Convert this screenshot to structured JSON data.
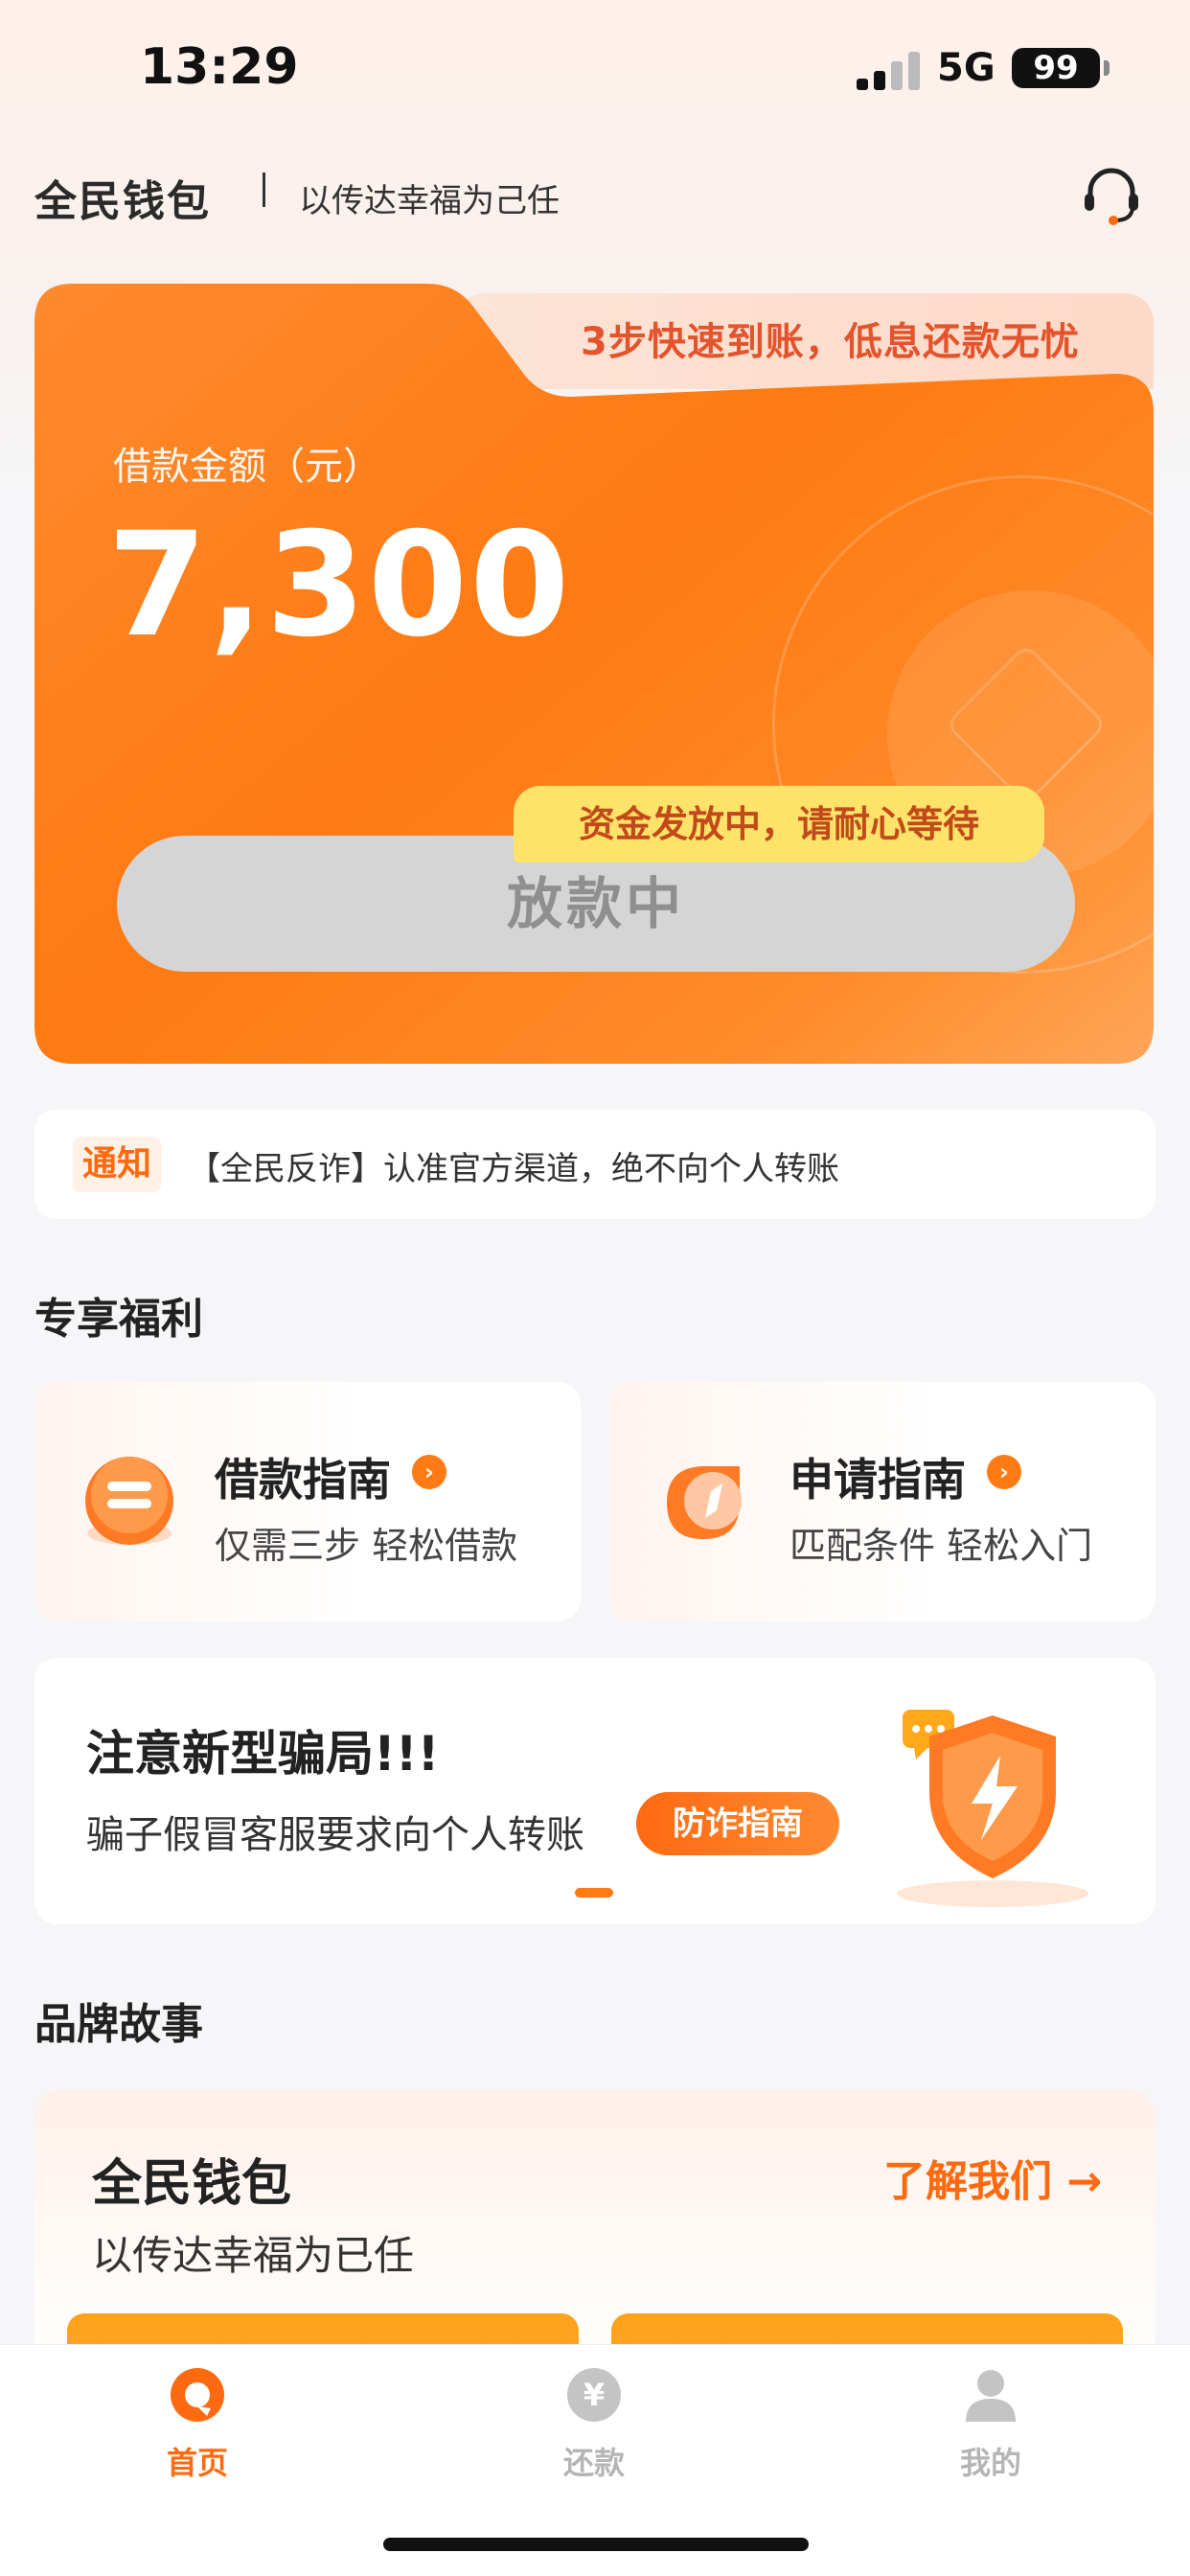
{
  "status_bar": {
    "time": "13:29",
    "network": "5G",
    "battery": "99"
  },
  "header": {
    "brand": "全民钱包",
    "tagline": "以传达幸福为己任",
    "support_icon": "headset-icon"
  },
  "loan_card": {
    "promo": "3步快速到账，低息还款无忧",
    "amount_label": "借款金额（元）",
    "amount": "7,300",
    "tooltip": "资金发放中，请耐心等待",
    "button_label": "放款中"
  },
  "notice": {
    "tag": "通知",
    "text": "【全民反诈】认准官方渠道，绝不向个人转账"
  },
  "benefits": {
    "title": "专享福利",
    "items": [
      {
        "title": "借款指南",
        "subtitle": "仅需三步 轻松借款",
        "icon": "loan-guide-icon"
      },
      {
        "title": "申请指南",
        "subtitle": "匹配条件 轻松入门",
        "icon": "compass-icon"
      }
    ]
  },
  "fraud_banner": {
    "title": "注意新型骗局!!!",
    "subtitle": "骗子假冒客服要求向个人转账",
    "button": "防诈指南",
    "icon": "shield-lightning-icon"
  },
  "brand_story": {
    "section_title": "品牌故事",
    "title": "全民钱包",
    "subtitle": "以传达幸福为已任",
    "link": "了解我们 →"
  },
  "tabbar": {
    "items": [
      {
        "label": "首页",
        "icon": "home-icon",
        "active": true
      },
      {
        "label": "还款",
        "icon": "yuan-icon",
        "active": false
      },
      {
        "label": "我的",
        "icon": "user-icon",
        "active": false
      }
    ]
  },
  "colors": {
    "accent": "#ff7a12",
    "active_tab": "#ff6a10",
    "inactive_tab": "#b5b5b5"
  }
}
